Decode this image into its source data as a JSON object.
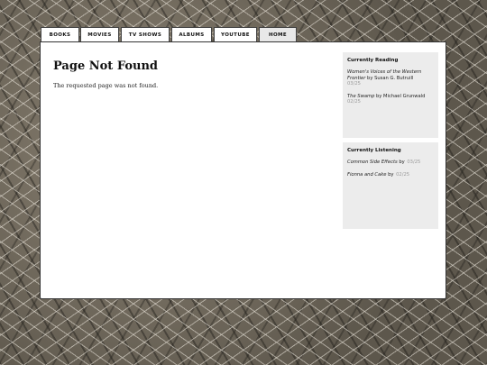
{
  "tabs": [
    {
      "label": "BOOKS"
    },
    {
      "label": "MOVIES"
    },
    {
      "label": "TV SHOWS"
    },
    {
      "label": "ALBUMS"
    },
    {
      "label": "YOUTUBE"
    },
    {
      "label": "HOME"
    }
  ],
  "main": {
    "title": "Page Not Found",
    "message": "The requested page was not found."
  },
  "reading": {
    "heading": "Currently Reading",
    "items": [
      {
        "title": "Women's Voices of the Western Frontier",
        "by": "by",
        "author": "Susan G. Butruill",
        "date": "03/25"
      },
      {
        "title": "The Swamp",
        "by": "by",
        "author": "Michael Grunwald",
        "date": "02/25"
      }
    ]
  },
  "listening": {
    "heading": "Currently Listening",
    "items": [
      {
        "title": "Common Side Effects",
        "by": "by",
        "date": "03/25"
      },
      {
        "title": "Fionna and Cake",
        "by": "by",
        "date": "02/25"
      }
    ]
  }
}
